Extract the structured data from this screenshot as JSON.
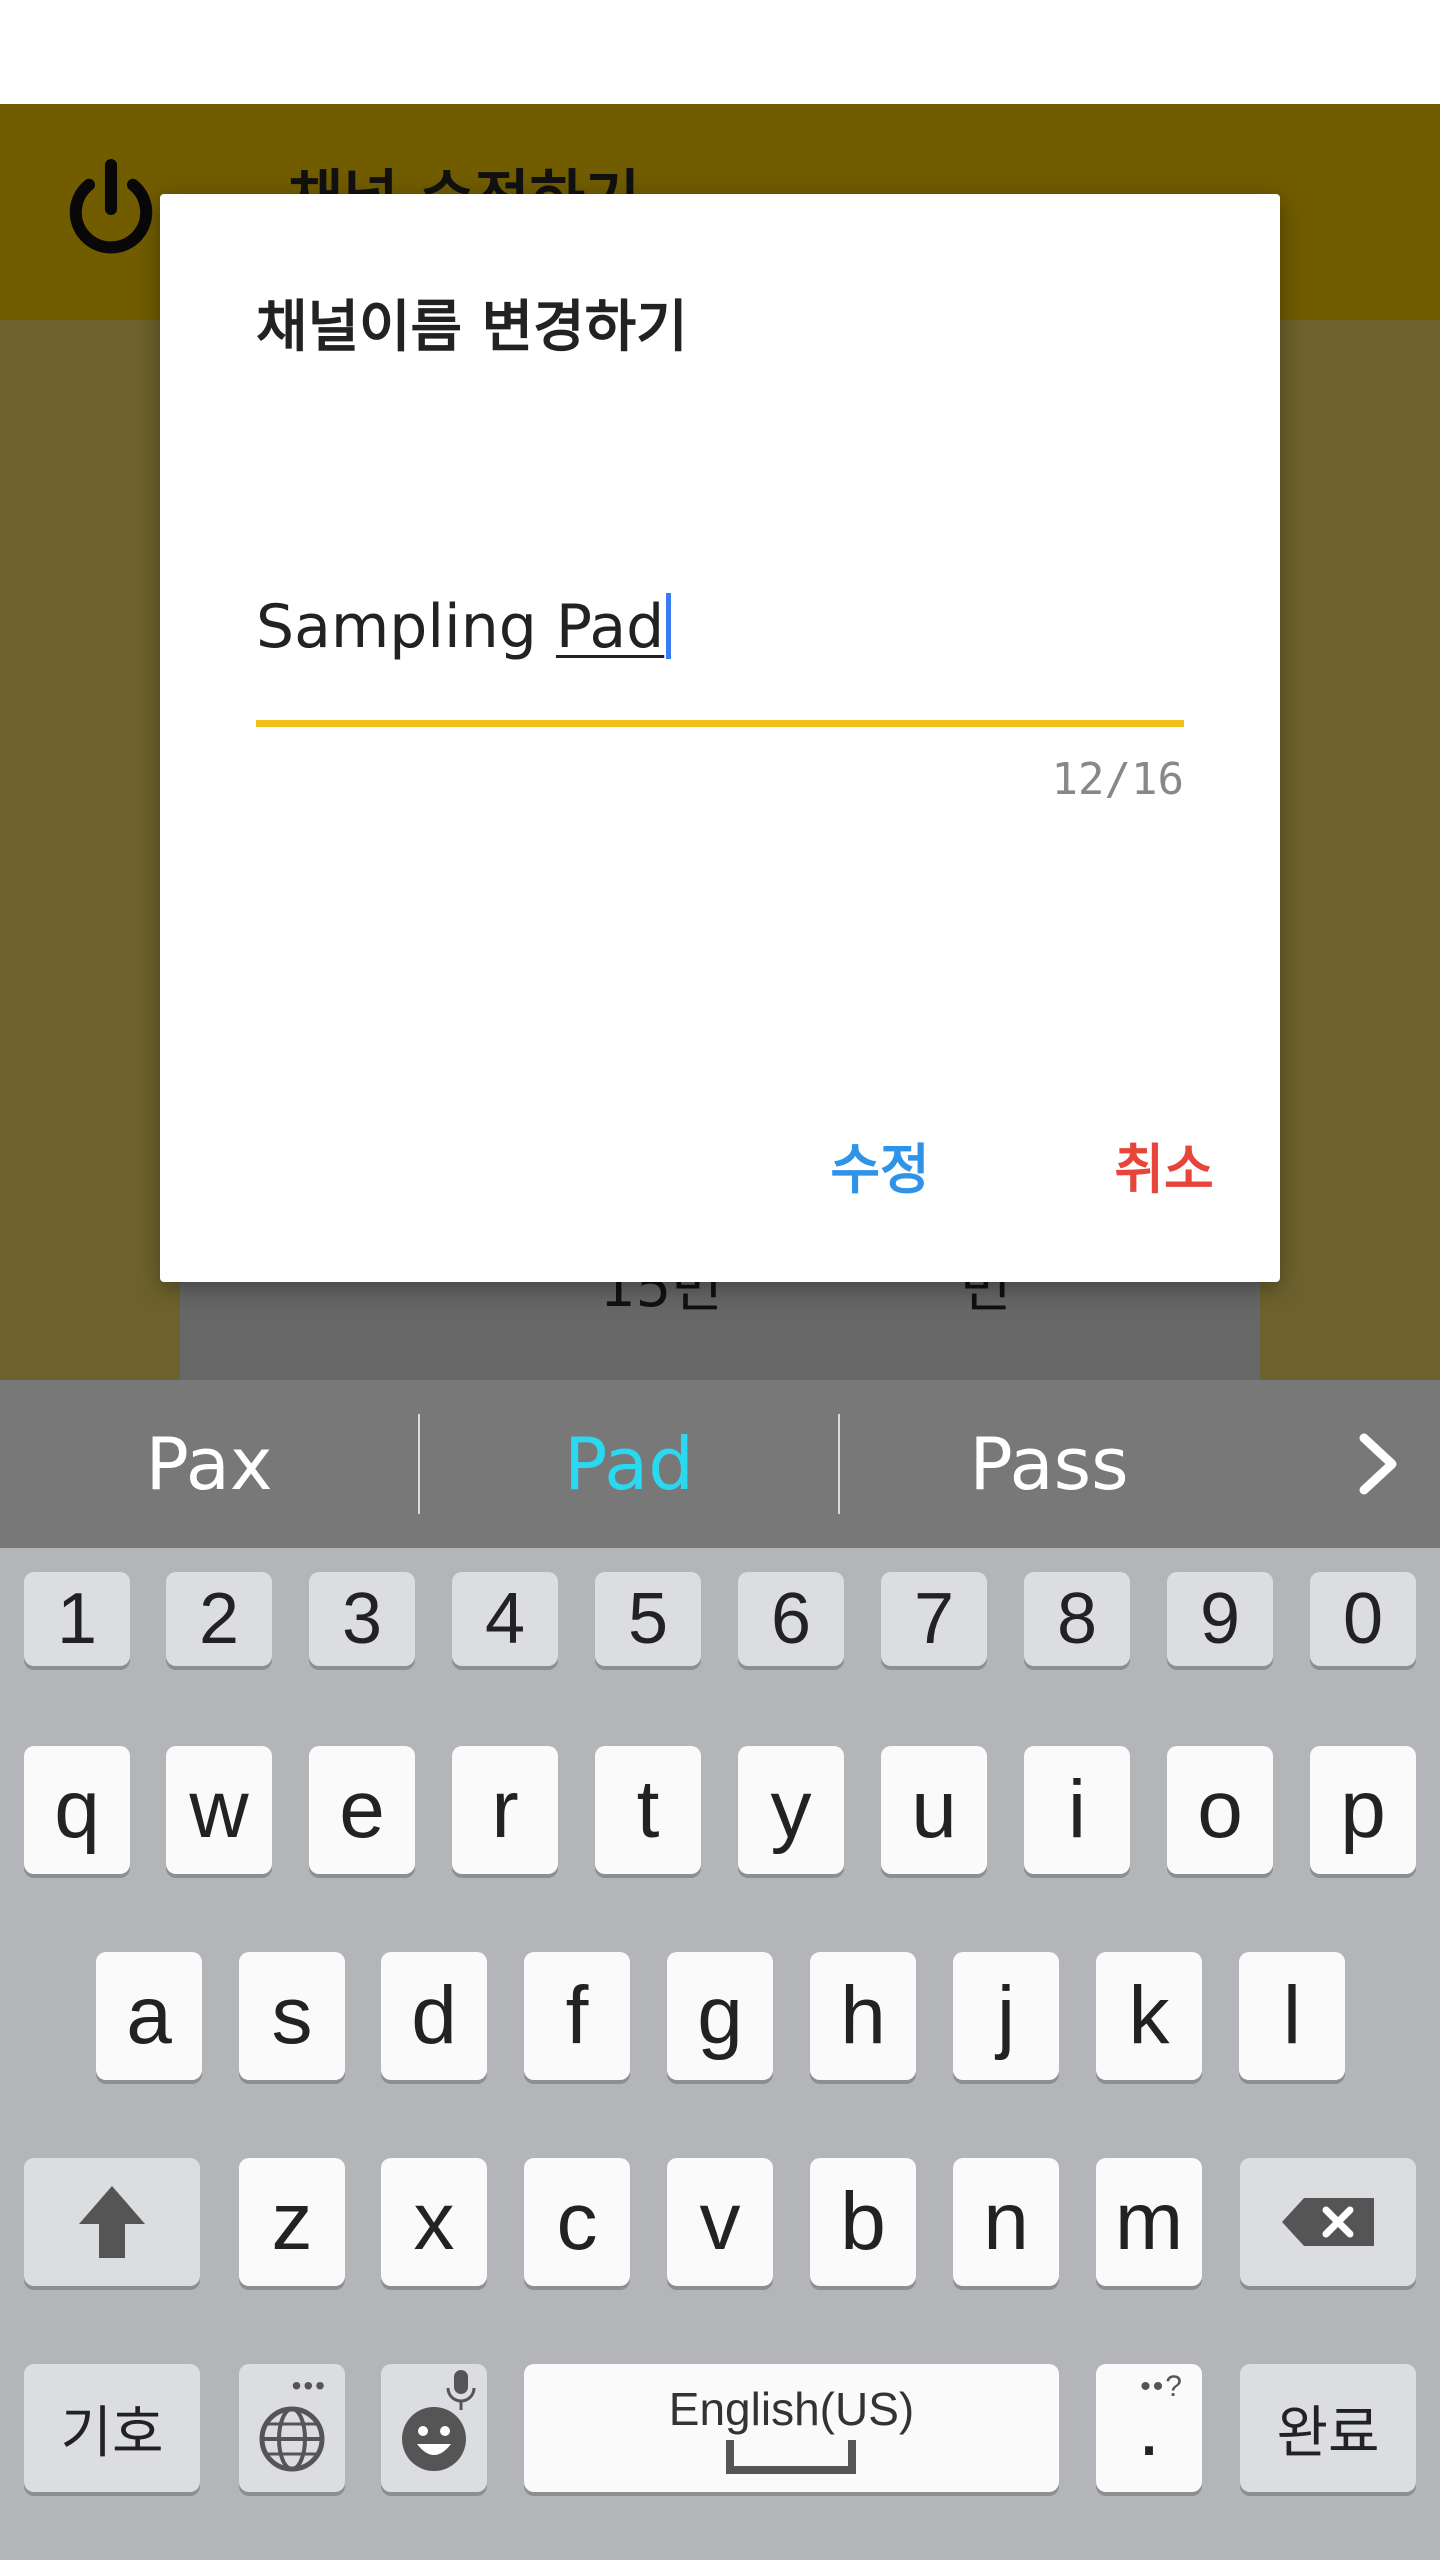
{
  "app_bar": {
    "title": "채널 수정하기"
  },
  "content": {
    "left_text": "15번",
    "right_text": "번"
  },
  "dialog": {
    "title": "채널이름 변경하기",
    "input_value": "Sampling Pad",
    "input_prefix": "Sampling ",
    "input_composing": "Pad",
    "counter": "12/16",
    "confirm_label": "수정",
    "cancel_label": "취소",
    "colors": {
      "accent_underline": "#f5bf1a",
      "confirm": "#2f93e8",
      "cancel": "#e8453a",
      "cursor": "#3a7bf2"
    }
  },
  "suggestions": [
    {
      "label": "Pax",
      "active": false
    },
    {
      "label": "Pad",
      "active": true
    },
    {
      "label": "Pass",
      "active": false
    }
  ],
  "keyboard": {
    "numbers": [
      "1",
      "2",
      "3",
      "4",
      "5",
      "6",
      "7",
      "8",
      "9",
      "0"
    ],
    "row1": [
      "q",
      "w",
      "e",
      "r",
      "t",
      "y",
      "u",
      "i",
      "o",
      "p"
    ],
    "row2": [
      "a",
      "s",
      "d",
      "f",
      "g",
      "h",
      "j",
      "k",
      "l"
    ],
    "row3": [
      "z",
      "x",
      "c",
      "v",
      "b",
      "n",
      "m"
    ],
    "symbols_label": "기호",
    "space_label": "English(US)",
    "period_label": ".",
    "done_label": "완료",
    "icons": {
      "shift": "shift-icon",
      "backspace": "backspace-icon",
      "globe": "globe-icon",
      "emoji": "emoji-icon",
      "mic": "mic-icon"
    }
  }
}
